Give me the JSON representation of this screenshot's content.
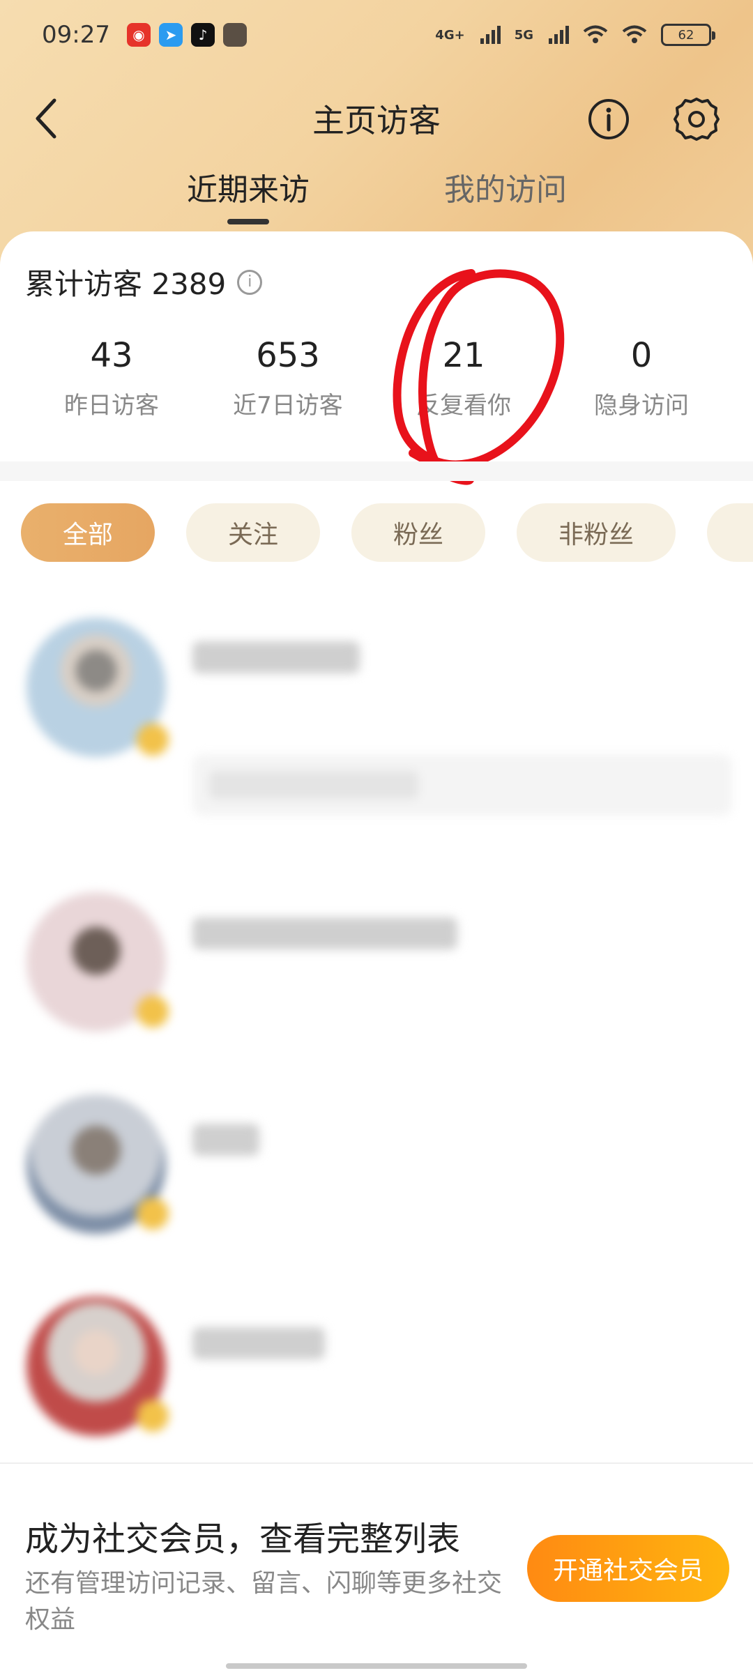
{
  "status_bar": {
    "time": "09:27",
    "net1": "4G+",
    "net2": "5G",
    "battery": "62",
    "apps": [
      "weibo-icon",
      "telegram-icon",
      "tiktok-icon",
      "app-square-icon"
    ]
  },
  "header": {
    "title": "主页访客",
    "back_icon": "chevron-left-icon",
    "info_icon": "info-icon",
    "settings_icon": "gear-icon"
  },
  "tabs": [
    {
      "label": "近期来访",
      "active": true
    },
    {
      "label": "我的访问",
      "active": false
    }
  ],
  "summary": {
    "total_label": "累计访客 2389"
  },
  "stats": [
    {
      "value": "43",
      "label": "昨日访客"
    },
    {
      "value": "653",
      "label": "近7日访客"
    },
    {
      "value": "21",
      "label": "反复看你"
    },
    {
      "value": "0",
      "label": "隐身访问"
    }
  ],
  "filters": [
    {
      "label": "全部",
      "active": true
    },
    {
      "label": "关注",
      "active": false
    },
    {
      "label": "粉丝",
      "active": false
    },
    {
      "label": "非粉丝",
      "active": false
    },
    {
      "label": "",
      "active": false
    }
  ],
  "promo": {
    "title": "成为社交会员，查看完整列表",
    "description": "还有管理访问记录、留言、闪聊等更多社交权益",
    "button_label": "开通社交会员"
  },
  "colors": {
    "accent_orange": "#ff9a12",
    "chip_active": "#e9b06c",
    "chip_inactive": "#f7f1e3",
    "annotation_red": "#e8121b"
  }
}
